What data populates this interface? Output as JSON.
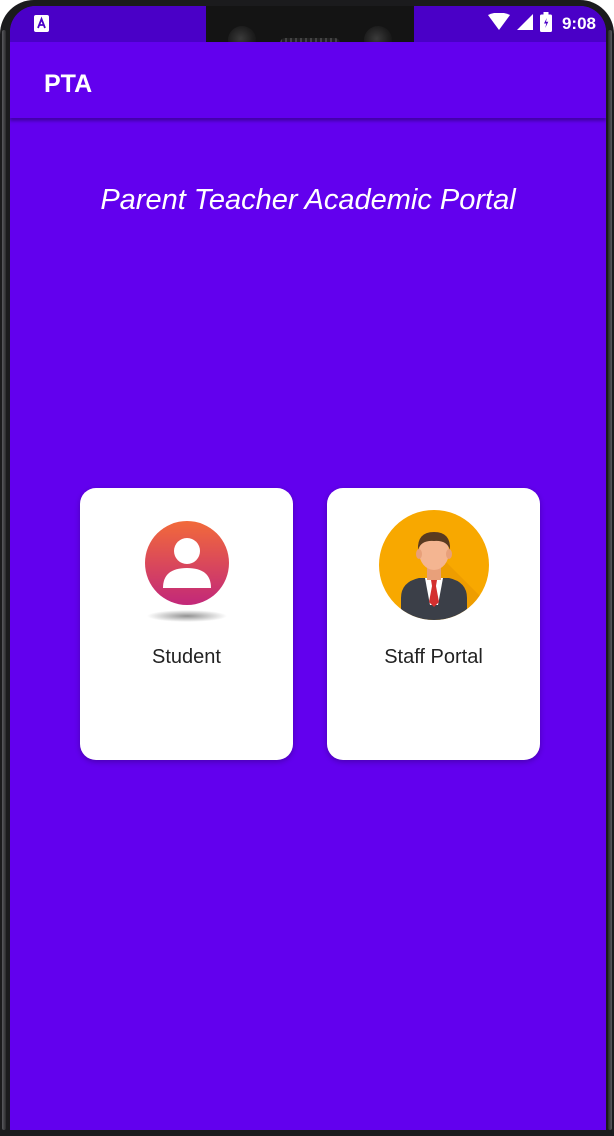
{
  "status_bar": {
    "time": "9:08",
    "left_icon": "a-notification-icon",
    "right_icons": [
      "wifi-icon",
      "signal-icon",
      "battery-icon"
    ]
  },
  "app_bar": {
    "title": "PTA"
  },
  "main": {
    "heading": "Parent Teacher Academic Portal",
    "cards": [
      {
        "label": "Student",
        "icon": "student-avatar-icon"
      },
      {
        "label": "Staff Portal",
        "icon": "staff-avatar-icon"
      }
    ]
  },
  "colors": {
    "primary": "#6200EE",
    "status_bar": "#4a00c7",
    "card_background": "#ffffff",
    "student_icon_gradient": [
      "#f26a3a",
      "#c2287a"
    ],
    "staff_icon_background": "#f8a800"
  }
}
